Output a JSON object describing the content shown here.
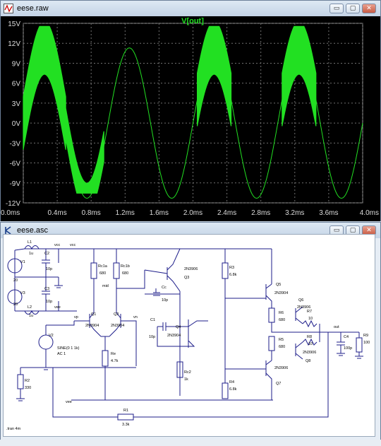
{
  "plot_window": {
    "title": "eese.raw",
    "icon": "waveform-icon",
    "controls": {
      "minimize": "▭",
      "maximize": "▢",
      "close": "✕"
    }
  },
  "schematic_window": {
    "title": "eese.asc",
    "icon": "schematic-icon",
    "controls": {
      "minimize": "▭",
      "maximize": "▢",
      "close": "✕"
    }
  },
  "chart_data": {
    "type": "line",
    "title": "V[out]",
    "xlabel": "",
    "ylabel": "",
    "x_ticks": [
      "0.0ms",
      "0.4ms",
      "0.8ms",
      "1.2ms",
      "1.6ms",
      "2.0ms",
      "2.4ms",
      "2.8ms",
      "3.2ms",
      "3.6ms",
      "4.0ms"
    ],
    "y_ticks": [
      "15V",
      "12V",
      "9V",
      "6V",
      "3V",
      "0V",
      "-3V",
      "-6V",
      "-9V",
      "-12V"
    ],
    "xlim": [
      0,
      4.0
    ],
    "ylim": [
      -12,
      15
    ],
    "grid": true,
    "series": [
      {
        "name": "V[out]",
        "color": "#22e022",
        "frequency_khz": 1.0,
        "amplitude_v": 11.3,
        "oscillation_bands_ms": [
          [
            0.0,
            0.95
          ],
          [
            2.05,
            2.45
          ],
          [
            3.05,
            3.45
          ]
        ],
        "oscillation_peak_v": 14.6,
        "oscillation_trough_v": -10.6
      }
    ]
  },
  "schematic": {
    "labels": {
      "L1": "L1",
      "L1_val": "1u",
      "L2": "L2",
      "L2_val": "1u",
      "V1": "V1",
      "V1_val": "20",
      "V3": "V3",
      "V3_val": "20",
      "C2": "C2",
      "C2_val": "10p",
      "C3": "C3",
      "C3_val": "10p",
      "vcc1": "vcc",
      "vee1": "vee",
      "vcc2": "vcc",
      "vee2": "vee",
      "Rc1a": "Rc1a",
      "Rc1a_val": "680",
      "Rc1b": "Rc1b",
      "Rc1b_val": "680",
      "mid": "mid",
      "Q1": "Q1",
      "Q1_model": "2N3904",
      "Q2": "Q2",
      "Q2_model": "2N3904",
      "vp": "vp",
      "vn": "vn",
      "V2": "V2",
      "V2_val": "SINE(0 1 1k)",
      "V2_ac": "AC 1",
      "Re": "Re",
      "Re_val": "4.7k",
      "R2": "R2",
      "R2_val": "330",
      "Q3": "Q3",
      "Q3_model": "2N3906",
      "Cc": "Cc",
      "Cc_val": "10p",
      "C1": "C1",
      "C1_val": "10p",
      "Q4": "Q4",
      "Q4_model": "2N3904",
      "Rc2": "Rc2",
      "Rc2_val": "1k",
      "R3": "R3",
      "R3_val": "6.8k",
      "R4": "R4",
      "R4_val": "6.8k",
      "Q5": "Q5",
      "Q5_model": "2N3904",
      "Q6": "Q6",
      "Q6_model": "2N3906",
      "R6": "R6",
      "R6_val": "680",
      "R5": "R5",
      "R5_val": "680",
      "R7": "R7",
      "R7_val": "10",
      "R8": "R8",
      "R8_val": "10",
      "Q8": "Q8",
      "Q8_model": "2N3906",
      "Q7": "Q7",
      "Q7_model": "2N3906",
      "out": "out",
      "C4": "C4",
      "C4_val": "100p",
      "R9": "R9",
      "R9_val": "100",
      "R1": "R1",
      "R1_val": "3.3k",
      "tran": ".tran 4m"
    }
  }
}
